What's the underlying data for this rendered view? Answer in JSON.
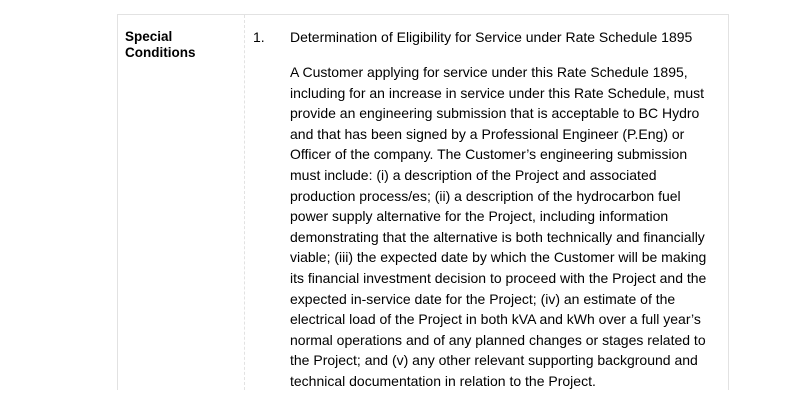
{
  "section": {
    "label": "Special Conditions",
    "item_number": "1.",
    "heading": "Determination of Eligibility for Service under Rate Schedule 1895",
    "body_lines": [
      "A Customer applying for service under this Rate Schedule 1895,",
      "including for an increase in service under this Rate Schedule, must",
      "provide an engineering submission that is acceptable to BC Hydro",
      "and that has been signed by a Professional Engineer (P.Eng) or",
      "Officer of the company. The Customer’s engineering submission",
      "must include: (i) a description of the Project and associated",
      "production process/es; (ii) a description of the hydrocarbon fuel",
      "power supply alternative for the Project, including information",
      "demonstrating that the alternative is both technically and financially",
      "viable; (iii) the expected date by which the Customer will be making",
      "its financial investment decision to proceed with the Project and the",
      "expected in-service date for the Project; (iv) an estimate of the",
      "electrical load of the Project in both kVA and kWh over a full year’s",
      "normal operations and of any planned changes or stages related to",
      "the Project; and (v) any other relevant supporting background and",
      "technical documentation in relation to the Project."
    ]
  }
}
